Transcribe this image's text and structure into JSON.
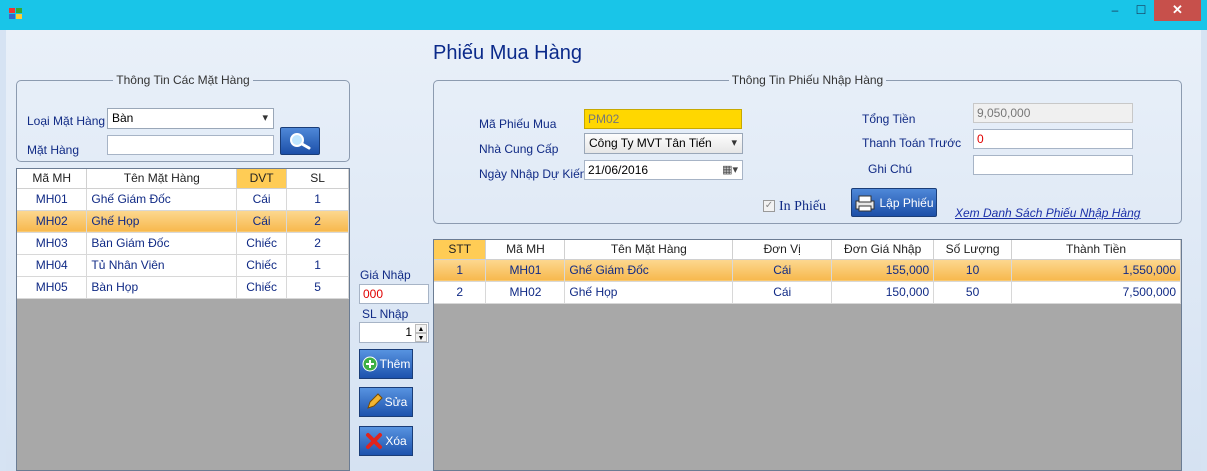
{
  "window": {
    "title": "",
    "controls": {
      "minimize": "–",
      "maximize": "☐",
      "close": "✕"
    }
  },
  "page_title": "Phiếu Mua Hàng",
  "product_group": {
    "legend": "Thông Tin Các Mặt Hàng",
    "category_label": "Loại Mặt Hàng",
    "category_value": "Bàn",
    "item_label": "Mặt Hàng",
    "item_value": ""
  },
  "product_grid": {
    "columns": [
      "Mã MH",
      "Tên Mặt Hàng",
      "DVT",
      "SL"
    ],
    "rows": [
      {
        "code": "MH01",
        "name": "Ghế Giám Đốc",
        "unit": "Cái",
        "qty": "1"
      },
      {
        "code": "MH02",
        "name": "Ghế Họp",
        "unit": "Cái",
        "qty": "2"
      },
      {
        "code": "MH03",
        "name": "Bàn Giám Đốc",
        "unit": "Chiếc",
        "qty": "2"
      },
      {
        "code": "MH04",
        "name": "Tủ Nhân Viên",
        "unit": "Chiếc",
        "qty": "1"
      },
      {
        "code": "MH05",
        "name": "Bàn Họp",
        "unit": "Chiếc",
        "qty": "5"
      }
    ]
  },
  "entry": {
    "price_label": "Giá Nhập",
    "price_value": "000",
    "qty_label": "SL Nhập",
    "qty_value": "1",
    "add_label": "Thêm",
    "edit_label": "Sửa",
    "delete_label": "Xóa"
  },
  "receipt_group": {
    "legend": "Thông Tin Phiếu Nhập Hàng",
    "code_label": "Mã Phiếu Mua",
    "code_value": "PM02",
    "supplier_label": "Nhà Cung Cấp",
    "supplier_value": "Công Ty MVT Tân Tiến",
    "date_label": "Ngày Nhập Dự Kiến",
    "date_value": "21/06/2016",
    "total_label": "Tổng Tiền",
    "total_value": "9,050,000",
    "prepay_label": "Thanh Toán Trước",
    "prepay_value": "0",
    "note_label": "Ghi Chú",
    "note_value": "",
    "print_label": "In Phiếu",
    "create_label": "Lập Phiếu",
    "list_link": "Xem Danh Sách Phiếu Nhập Hàng"
  },
  "detail_grid": {
    "columns": [
      "STT",
      "Mã MH",
      "Tên Mặt Hàng",
      "Đơn Vị",
      "Đơn Giá Nhập",
      "Số Lượng",
      "Thành Tiền"
    ],
    "rows": [
      {
        "stt": "1",
        "code": "MH01",
        "name": "Ghế Giám Đốc",
        "unit": "Cái",
        "price": "155,000",
        "qty": "10",
        "amount": "1,550,000"
      },
      {
        "stt": "2",
        "code": "MH02",
        "name": "Ghế Họp",
        "unit": "Cái",
        "price": "150,000",
        "qty": "50",
        "amount": "7,500,000"
      }
    ]
  },
  "colors": {
    "titlebar": "#19c5e8",
    "selection": "#f7b84d",
    "close": "#c7504b",
    "code_field": "#ffd700"
  }
}
